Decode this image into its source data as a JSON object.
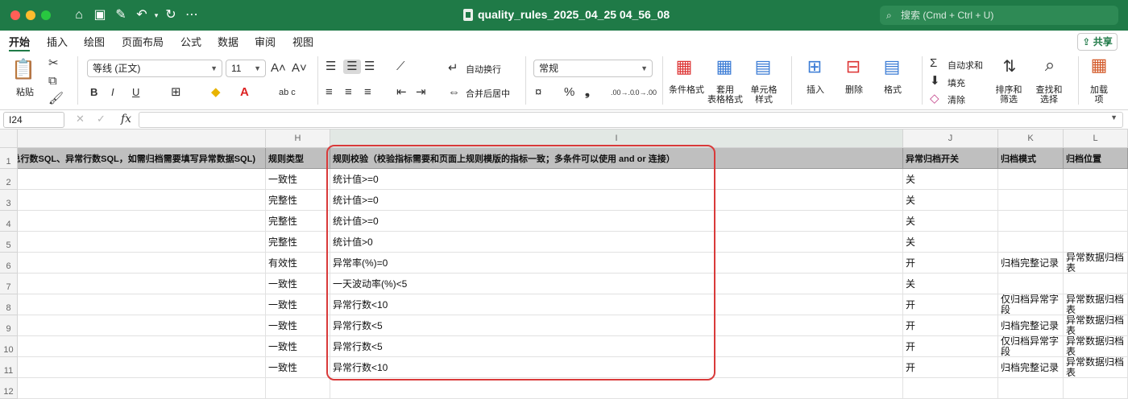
{
  "window": {
    "title": "quality_rules_2025_04_25 04_56_08",
    "search_placeholder": "搜索 (Cmd + Ctrl + U)"
  },
  "menu": {
    "tabs": [
      "开始",
      "插入",
      "绘图",
      "页面布局",
      "公式",
      "数据",
      "审阅",
      "视图"
    ],
    "active": "开始",
    "share": "共享"
  },
  "ribbon": {
    "paste": "粘贴",
    "font_name": "等线 (正文)",
    "font_size": "11",
    "bold": "B",
    "italic": "I",
    "underline": "U",
    "wrap_text": "自动换行",
    "merge_center": "合并后居中",
    "number_format": "常规",
    "percent": "%",
    "comma": "❟",
    "dec_inc": ".00→.0",
    "dec_dec": ".0→.00",
    "cond_format": "条件格式",
    "table_format_1": "套用",
    "table_format_2": "表格格式",
    "cell_style_1": "单元格",
    "cell_style_2": "样式",
    "insert": "插入",
    "delete": "删除",
    "format": "格式",
    "autosum": "自动求和",
    "fill": "填充",
    "clear": "清除",
    "sort_filter_1": "排序和",
    "sort_filter_2": "筛选",
    "find_select_1": "查找和",
    "find_select_2": "选择",
    "addins_1": "加载",
    "addins_2": "项"
  },
  "formula_bar": {
    "cell_ref": "I24",
    "fx": "fx",
    "value": ""
  },
  "grid": {
    "columns": [
      "",
      "H",
      "I",
      "J",
      "K",
      "L"
    ],
    "rows": [
      "1",
      "2",
      "3",
      "4",
      "5",
      "6",
      "7",
      "8",
      "9",
      "10",
      "11",
      "12"
    ],
    "header_row": {
      "g": "总行数SQL、异常行数SQL，如需归档需要填写异常数据SQL)",
      "h": "规则类型",
      "i": "规则校验（校验指标需要和页面上规则模版的指标一致；多条件可以使用 and or 连接）",
      "j": "异常归档开关",
      "k": "归档模式",
      "l": "归档位置"
    },
    "data_rows": [
      {
        "h": "一致性",
        "i": "统计值>=0",
        "j": "关",
        "k": "",
        "l": ""
      },
      {
        "h": "完整性",
        "i": "统计值>=0",
        "j": "关",
        "k": "",
        "l": ""
      },
      {
        "h": "完整性",
        "i": "统计值>=0",
        "j": "关",
        "k": "",
        "l": ""
      },
      {
        "h": "完整性",
        "i": "统计值>0",
        "j": "关",
        "k": "",
        "l": ""
      },
      {
        "h": "有效性",
        "i": "异常率(%)=0",
        "j": "开",
        "k": "归档完整记录",
        "l": "异常数据归档表"
      },
      {
        "h": "一致性",
        "i": "一天波动率(%)<5",
        "j": "关",
        "k": "",
        "l": ""
      },
      {
        "h": "一致性",
        "i": "异常行数<10",
        "j": "开",
        "k": "仅归档异常字段",
        "l": "异常数据归档表"
      },
      {
        "h": "一致性",
        "i": "异常行数<5",
        "j": "开",
        "k": "归档完整记录",
        "l": "异常数据归档表"
      },
      {
        "h": "一致性",
        "i": "异常行数<5",
        "j": "开",
        "k": "仅归档异常字段",
        "l": "异常数据归档表"
      },
      {
        "h": "一致性",
        "i": "异常行数<10",
        "j": "开",
        "k": "归档完整记录",
        "l": "异常数据归档表"
      },
      {
        "h": "",
        "i": "",
        "j": "",
        "k": "",
        "l": ""
      }
    ]
  },
  "colors": {
    "brand": "#1f7a47",
    "highlight": "#d93a3a",
    "header_fill": "#bfbfbf"
  }
}
